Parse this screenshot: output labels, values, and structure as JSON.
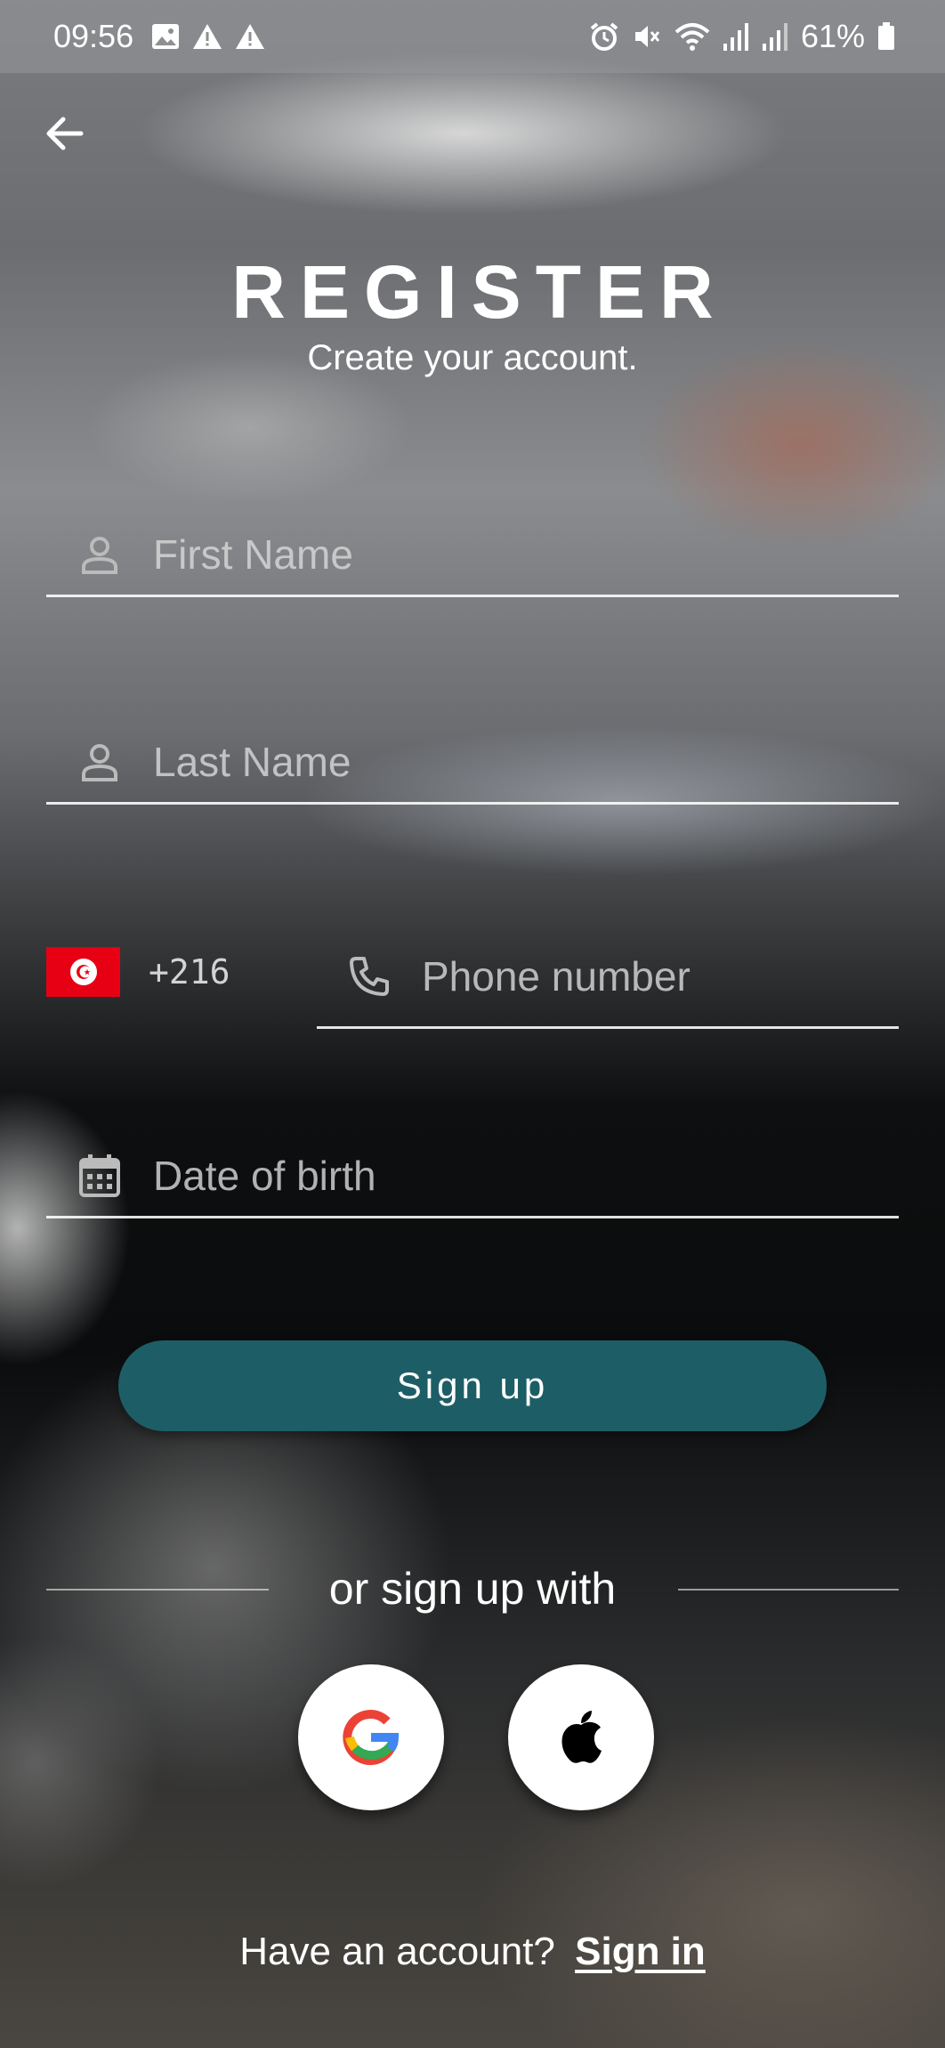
{
  "status_bar": {
    "time": "09:56",
    "battery": "61%",
    "left_icons": [
      "image-icon",
      "warning-icon",
      "warning-icon"
    ],
    "right_icons": [
      "alarm-icon",
      "mute-icon",
      "wifi-icon",
      "signal-icon",
      "signal-icon",
      "battery-icon"
    ]
  },
  "header": {
    "title": "REGISTER",
    "subtitle": "Create your account."
  },
  "form": {
    "first_name": {
      "placeholder": "First Name",
      "icon": "person-icon"
    },
    "last_name": {
      "placeholder": "Last Name",
      "icon": "person-icon"
    },
    "phone": {
      "country_code": "+216",
      "placeholder": "Phone number",
      "icon": "phone-icon",
      "flag": "tunisia-flag-icon"
    },
    "dob": {
      "placeholder": "Date of birth",
      "icon": "calendar-icon"
    },
    "submit_label": "Sign up"
  },
  "social": {
    "divider_text": "or sign up with",
    "providers": [
      "google",
      "apple"
    ]
  },
  "footer": {
    "prompt": "Have an account?",
    "link": "Sign in"
  },
  "colors": {
    "primary_button": "#1d5e66",
    "flag_red": "#e70013"
  }
}
